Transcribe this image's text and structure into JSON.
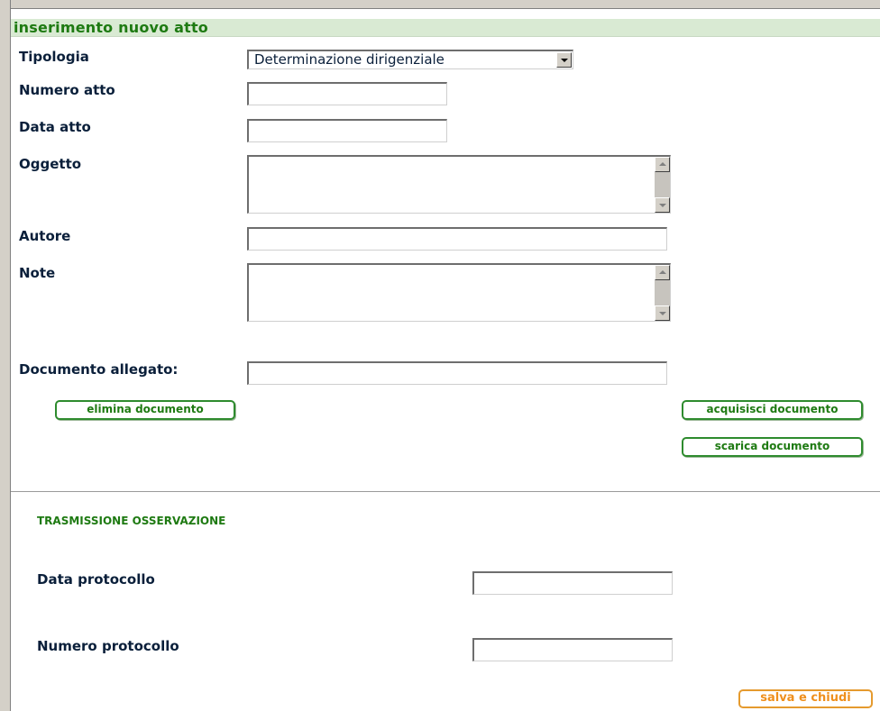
{
  "header": {
    "title": "inserimento nuovo atto"
  },
  "form": {
    "tipologia": {
      "label": "Tipologia",
      "value": "Determinazione dirigenziale"
    },
    "numero_atto": {
      "label": "Numero atto",
      "value": ""
    },
    "data_atto": {
      "label": "Data atto",
      "value": ""
    },
    "oggetto": {
      "label": "Oggetto",
      "value": ""
    },
    "autore": {
      "label": "Autore",
      "value": ""
    },
    "note": {
      "label": "Note",
      "value": ""
    },
    "documento_allegato": {
      "label": "Documento allegato:",
      "value": ""
    }
  },
  "buttons": {
    "elimina": "elimina documento",
    "acquisisci": "acquisisci documento",
    "scarica": "scarica documento",
    "salva": "salva e chiudi"
  },
  "trasmissione": {
    "title": "TRASMISSIONE OSSERVAZIONE",
    "data_protocollo": {
      "label": "Data protocollo",
      "value": ""
    },
    "numero_protocollo": {
      "label": "Numero protocollo",
      "value": ""
    }
  },
  "colors": {
    "accent_green": "#1e7a12",
    "header_bg": "#d9ead3",
    "label_navy": "#0a1f3a",
    "save_orange": "#ef8f1c"
  },
  "icons": [
    "dropdown-arrow-icon",
    "scroll-up-icon",
    "scroll-down-icon"
  ]
}
